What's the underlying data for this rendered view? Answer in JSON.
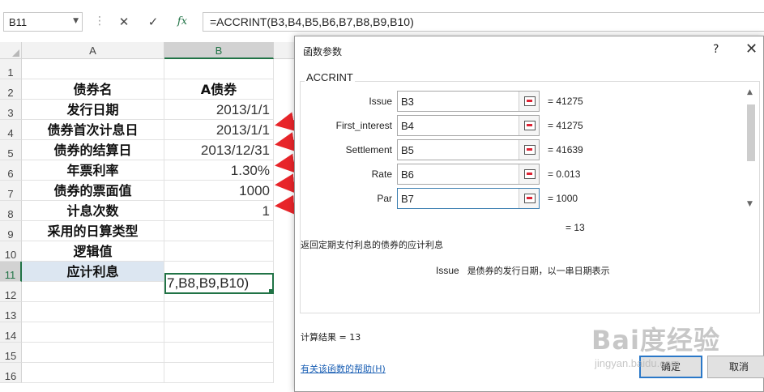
{
  "formula_bar": {
    "name_box": "B11",
    "cancel_glyph": "✕",
    "enter_glyph": "✓",
    "fx_label": "fx",
    "formula": "=ACCRINT(B3,B4,B5,B6,B7,B8,B9,B10)"
  },
  "sheet": {
    "columns": [
      "A",
      "B"
    ],
    "rows": [
      "1",
      "2",
      "3",
      "4",
      "5",
      "6",
      "7",
      "8",
      "9",
      "10",
      "11",
      "12",
      "13",
      "14",
      "15",
      "16"
    ],
    "colA": [
      "",
      "债券名",
      "发行日期",
      "债券首次计息日",
      "债券的结算日",
      "年票利率",
      "债券的票面值",
      "计息次数",
      "采用的日算类型",
      "逻辑值",
      "应计利息",
      "",
      "",
      "",
      "",
      ""
    ],
    "colB": [
      "",
      "A债券",
      "2013/1/1",
      "2013/1/1",
      "2013/12/31",
      "1.30%",
      "1000",
      "1",
      "",
      "",
      "",
      "",
      "",
      "",
      "",
      ""
    ],
    "active_cell_text": "7,B8,B9,B10)"
  },
  "dialog": {
    "title": "函数参数",
    "help_glyph": "?",
    "close_glyph": "✕",
    "function_name": "ACCRINT",
    "params": [
      {
        "label": "Issue",
        "value": "B3",
        "result": "=  41275"
      },
      {
        "label": "First_interest",
        "value": "B4",
        "result": "=  41275"
      },
      {
        "label": "Settlement",
        "value": "B5",
        "result": "=  41639"
      },
      {
        "label": "Rate",
        "value": "B6",
        "result": "=  0.013"
      },
      {
        "label": "Par",
        "value": "B7",
        "result": "=  1000"
      }
    ],
    "total_result": "=  13",
    "description": "返回定期支付利息的债券的应计利息",
    "arg_name": "Issue",
    "arg_description": "是债券的发行日期，以一串日期表示",
    "result_line": "计算结果 =   13",
    "help_link": "有关该函数的帮助(H)",
    "ok_label": "确定",
    "cancel_label": "取消"
  },
  "watermark": {
    "main": "Bai度经验",
    "sub": "jingyan.baidu.com"
  },
  "colors": {
    "excel_green": "#217346",
    "selection_fill": "#dce6f1",
    "arrow_red": "#e8252a",
    "link_blue": "#1a5fb4"
  }
}
